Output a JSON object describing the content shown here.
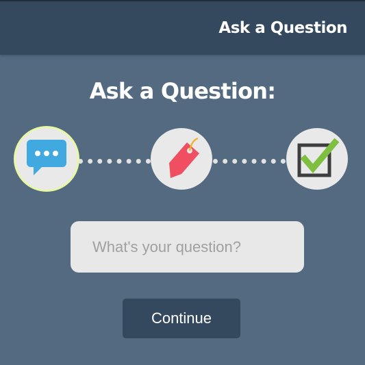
{
  "header": {
    "title": "Ask a Question"
  },
  "main": {
    "heading": "Ask a Question:",
    "steps": [
      {
        "icon": "speech-bubble-icon",
        "active": true
      },
      {
        "icon": "tag-icon",
        "active": false
      },
      {
        "icon": "checkbox-checked-icon",
        "active": false
      }
    ],
    "question_input": {
      "value": "",
      "placeholder": "What's your question?"
    },
    "continue_label": "Continue"
  },
  "colors": {
    "background": "#536a80",
    "header": "#34495e",
    "active_step_ring": "#e8f7a6",
    "speech_bubble": "#3fa9e0",
    "tag": "#ef4f60",
    "check": "#7fbf3f"
  }
}
